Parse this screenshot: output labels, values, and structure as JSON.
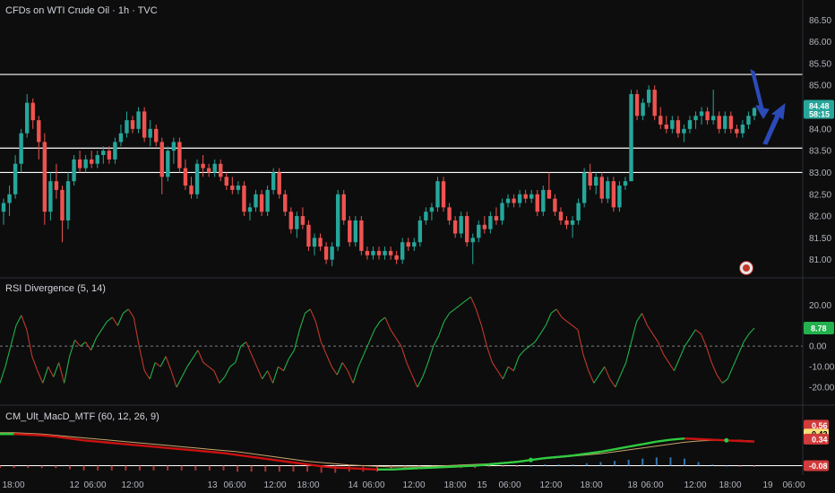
{
  "header": {
    "title": "CFDs on WTI Crude Oil · 1h · TVC",
    "rsi_title": "RSI Divergence (5, 14)",
    "macd_title": "CM_Ult_MacD_MTF (60, 12, 26, 9)"
  },
  "colors": {
    "background": "#0d0d0d",
    "up": "#26a69a",
    "down": "#ef5350",
    "rsi_up": "#22b14c",
    "rsi_down": "#c0392b",
    "hline": "#ffffff",
    "arrow": "#2b4bb8"
  },
  "chart_data": [
    {
      "type": "candlestick",
      "title": "CFDs on WTI Crude Oil · 1h · TVC",
      "y_ticks": [
        "86.50",
        "86.00",
        "85.50",
        "85.00",
        "84.50",
        "84.00",
        "83.50",
        "83.00",
        "82.50",
        "82.00",
        "81.50",
        "81.00"
      ],
      "ylim": [
        80.87,
        86.65
      ],
      "x_ticks": [
        "18:00",
        "12",
        "06:00",
        "12:00",
        "13",
        "06:00",
        "12:00",
        "18:00",
        "14",
        "06:00",
        "12:00",
        "18:00",
        "15",
        "06:00",
        "12:00",
        "18:00",
        "18",
        "06:00",
        "12:00",
        "18:00",
        "19",
        "06:00"
      ],
      "last_price": "84.48",
      "countdown": "58:15",
      "horizontal_levels": [
        85.25,
        83.56,
        83.0
      ],
      "grid": false,
      "candles": [
        {
          "o": 82.1,
          "h": 82.4,
          "l": 81.8,
          "c": 82.3
        },
        {
          "o": 82.3,
          "h": 82.7,
          "l": 82.0,
          "c": 82.5
        },
        {
          "o": 82.5,
          "h": 83.4,
          "l": 82.4,
          "c": 83.2
        },
        {
          "o": 83.2,
          "h": 84.0,
          "l": 83.0,
          "c": 83.9
        },
        {
          "o": 83.9,
          "h": 84.8,
          "l": 83.8,
          "c": 84.6
        },
        {
          "o": 84.6,
          "h": 84.7,
          "l": 84.0,
          "c": 84.2
        },
        {
          "o": 84.2,
          "h": 84.3,
          "l": 83.3,
          "c": 83.7
        },
        {
          "o": 83.7,
          "h": 83.9,
          "l": 81.8,
          "c": 82.1
        },
        {
          "o": 82.1,
          "h": 83.0,
          "l": 81.9,
          "c": 82.8
        },
        {
          "o": 82.8,
          "h": 83.2,
          "l": 82.4,
          "c": 82.6
        },
        {
          "o": 82.6,
          "h": 82.7,
          "l": 81.4,
          "c": 81.9
        },
        {
          "o": 81.9,
          "h": 83.0,
          "l": 81.7,
          "c": 82.8
        },
        {
          "o": 82.8,
          "h": 83.4,
          "l": 82.7,
          "c": 83.3
        },
        {
          "o": 83.3,
          "h": 83.5,
          "l": 83.0,
          "c": 83.1
        },
        {
          "o": 83.1,
          "h": 83.4,
          "l": 83.0,
          "c": 83.3
        },
        {
          "o": 83.3,
          "h": 83.5,
          "l": 83.1,
          "c": 83.2
        },
        {
          "o": 83.2,
          "h": 83.5,
          "l": 83.1,
          "c": 83.4
        },
        {
          "o": 83.4,
          "h": 83.6,
          "l": 83.2,
          "c": 83.5
        },
        {
          "o": 83.5,
          "h": 83.6,
          "l": 83.2,
          "c": 83.3
        },
        {
          "o": 83.3,
          "h": 83.8,
          "l": 83.2,
          "c": 83.7
        },
        {
          "o": 83.7,
          "h": 84.1,
          "l": 83.6,
          "c": 83.9
        },
        {
          "o": 83.9,
          "h": 84.4,
          "l": 83.8,
          "c": 84.2
        },
        {
          "o": 84.2,
          "h": 84.3,
          "l": 83.9,
          "c": 84.0
        },
        {
          "o": 84.0,
          "h": 84.5,
          "l": 83.9,
          "c": 84.4
        },
        {
          "o": 84.4,
          "h": 84.5,
          "l": 83.7,
          "c": 83.8
        },
        {
          "o": 83.8,
          "h": 84.2,
          "l": 83.6,
          "c": 84.0
        },
        {
          "o": 84.0,
          "h": 84.1,
          "l": 83.6,
          "c": 83.7
        },
        {
          "o": 83.7,
          "h": 83.8,
          "l": 82.5,
          "c": 82.9
        },
        {
          "o": 82.9,
          "h": 83.6,
          "l": 82.8,
          "c": 83.5
        },
        {
          "o": 83.5,
          "h": 83.8,
          "l": 83.2,
          "c": 83.7
        },
        {
          "o": 83.7,
          "h": 83.8,
          "l": 83.0,
          "c": 83.1
        },
        {
          "o": 83.1,
          "h": 83.3,
          "l": 82.6,
          "c": 82.7
        },
        {
          "o": 82.7,
          "h": 82.9,
          "l": 82.4,
          "c": 82.5
        },
        {
          "o": 82.5,
          "h": 83.3,
          "l": 82.4,
          "c": 83.2
        },
        {
          "o": 83.2,
          "h": 83.4,
          "l": 82.9,
          "c": 83.1
        },
        {
          "o": 83.1,
          "h": 83.2,
          "l": 82.9,
          "c": 83.0
        },
        {
          "o": 83.0,
          "h": 83.3,
          "l": 82.9,
          "c": 83.2
        },
        {
          "o": 83.2,
          "h": 83.3,
          "l": 82.8,
          "c": 82.9
        },
        {
          "o": 82.9,
          "h": 83.0,
          "l": 82.6,
          "c": 82.7
        },
        {
          "o": 82.7,
          "h": 82.9,
          "l": 82.5,
          "c": 82.6
        },
        {
          "o": 82.6,
          "h": 82.8,
          "l": 82.5,
          "c": 82.7
        },
        {
          "o": 82.7,
          "h": 82.8,
          "l": 82.0,
          "c": 82.1
        },
        {
          "o": 82.1,
          "h": 82.3,
          "l": 81.9,
          "c": 82.2
        },
        {
          "o": 82.2,
          "h": 82.6,
          "l": 82.1,
          "c": 82.5
        },
        {
          "o": 82.5,
          "h": 82.6,
          "l": 82.0,
          "c": 82.1
        },
        {
          "o": 82.1,
          "h": 82.7,
          "l": 82.0,
          "c": 82.6
        },
        {
          "o": 82.6,
          "h": 83.1,
          "l": 82.5,
          "c": 83.0
        },
        {
          "o": 83.0,
          "h": 83.1,
          "l": 82.4,
          "c": 82.5
        },
        {
          "o": 82.5,
          "h": 82.6,
          "l": 82.0,
          "c": 82.1
        },
        {
          "o": 82.1,
          "h": 82.2,
          "l": 81.6,
          "c": 81.7
        },
        {
          "o": 81.7,
          "h": 82.1,
          "l": 81.5,
          "c": 82.0
        },
        {
          "o": 82.0,
          "h": 82.2,
          "l": 81.7,
          "c": 81.8
        },
        {
          "o": 81.8,
          "h": 81.9,
          "l": 81.2,
          "c": 81.3
        },
        {
          "o": 81.3,
          "h": 81.6,
          "l": 81.1,
          "c": 81.5
        },
        {
          "o": 81.5,
          "h": 81.6,
          "l": 81.2,
          "c": 81.3
        },
        {
          "o": 81.3,
          "h": 81.4,
          "l": 80.9,
          "c": 81.0
        },
        {
          "o": 81.0,
          "h": 81.4,
          "l": 80.85,
          "c": 81.3
        },
        {
          "o": 81.3,
          "h": 82.6,
          "l": 81.2,
          "c": 82.5
        },
        {
          "o": 82.5,
          "h": 82.6,
          "l": 81.8,
          "c": 81.9
        },
        {
          "o": 81.9,
          "h": 82.0,
          "l": 81.3,
          "c": 81.4
        },
        {
          "o": 81.4,
          "h": 82.0,
          "l": 81.3,
          "c": 81.9
        },
        {
          "o": 81.9,
          "h": 82.0,
          "l": 81.1,
          "c": 81.2
        },
        {
          "o": 81.2,
          "h": 81.3,
          "l": 81.0,
          "c": 81.1
        },
        {
          "o": 81.1,
          "h": 81.3,
          "l": 81.0,
          "c": 81.2
        },
        {
          "o": 81.2,
          "h": 81.3,
          "l": 81.0,
          "c": 81.1
        },
        {
          "o": 81.1,
          "h": 81.3,
          "l": 81.0,
          "c": 81.2
        },
        {
          "o": 81.2,
          "h": 81.3,
          "l": 81.0,
          "c": 81.1
        },
        {
          "o": 81.1,
          "h": 81.2,
          "l": 80.9,
          "c": 81.0
        },
        {
          "o": 81.0,
          "h": 81.5,
          "l": 80.9,
          "c": 81.4
        },
        {
          "o": 81.4,
          "h": 81.5,
          "l": 81.2,
          "c": 81.3
        },
        {
          "o": 81.3,
          "h": 81.5,
          "l": 81.2,
          "c": 81.4
        },
        {
          "o": 81.4,
          "h": 82.0,
          "l": 81.3,
          "c": 81.9
        },
        {
          "o": 81.9,
          "h": 82.2,
          "l": 81.8,
          "c": 82.1
        },
        {
          "o": 82.1,
          "h": 82.3,
          "l": 81.9,
          "c": 82.2
        },
        {
          "o": 82.2,
          "h": 82.9,
          "l": 82.1,
          "c": 82.8
        },
        {
          "o": 82.8,
          "h": 82.9,
          "l": 82.1,
          "c": 82.2
        },
        {
          "o": 82.2,
          "h": 82.3,
          "l": 81.8,
          "c": 81.9
        },
        {
          "o": 81.9,
          "h": 82.0,
          "l": 81.5,
          "c": 81.6
        },
        {
          "o": 81.6,
          "h": 82.1,
          "l": 81.5,
          "c": 82.0
        },
        {
          "o": 82.0,
          "h": 82.1,
          "l": 81.3,
          "c": 81.4
        },
        {
          "o": 81.4,
          "h": 81.6,
          "l": 80.9,
          "c": 81.5
        },
        {
          "o": 81.5,
          "h": 81.9,
          "l": 81.4,
          "c": 81.8
        },
        {
          "o": 81.8,
          "h": 82.0,
          "l": 81.6,
          "c": 81.7
        },
        {
          "o": 81.7,
          "h": 82.1,
          "l": 81.6,
          "c": 82.0
        },
        {
          "o": 82.0,
          "h": 82.2,
          "l": 81.8,
          "c": 81.9
        },
        {
          "o": 81.9,
          "h": 82.4,
          "l": 81.8,
          "c": 82.3
        },
        {
          "o": 82.3,
          "h": 82.5,
          "l": 82.2,
          "c": 82.4
        },
        {
          "o": 82.4,
          "h": 82.5,
          "l": 82.2,
          "c": 82.3
        },
        {
          "o": 82.3,
          "h": 82.6,
          "l": 82.2,
          "c": 82.5
        },
        {
          "o": 82.5,
          "h": 82.6,
          "l": 82.3,
          "c": 82.4
        },
        {
          "o": 82.4,
          "h": 82.6,
          "l": 82.3,
          "c": 82.5
        },
        {
          "o": 82.5,
          "h": 82.6,
          "l": 82.0,
          "c": 82.1
        },
        {
          "o": 82.1,
          "h": 82.7,
          "l": 82.0,
          "c": 82.6
        },
        {
          "o": 82.6,
          "h": 83.0,
          "l": 82.5,
          "c": 82.4
        },
        {
          "o": 82.4,
          "h": 82.5,
          "l": 82.0,
          "c": 82.1
        },
        {
          "o": 82.1,
          "h": 82.2,
          "l": 81.8,
          "c": 81.9
        },
        {
          "o": 81.9,
          "h": 82.0,
          "l": 81.7,
          "c": 81.8
        },
        {
          "o": 81.8,
          "h": 82.0,
          "l": 81.5,
          "c": 81.9
        },
        {
          "o": 81.9,
          "h": 82.4,
          "l": 81.8,
          "c": 82.3
        },
        {
          "o": 82.3,
          "h": 83.1,
          "l": 82.2,
          "c": 83.0
        },
        {
          "o": 83.0,
          "h": 83.2,
          "l": 82.6,
          "c": 82.7
        },
        {
          "o": 82.7,
          "h": 83.0,
          "l": 82.5,
          "c": 82.9
        },
        {
          "o": 82.9,
          "h": 83.0,
          "l": 82.3,
          "c": 82.4
        },
        {
          "o": 82.4,
          "h": 82.9,
          "l": 82.3,
          "c": 82.8
        },
        {
          "o": 82.8,
          "h": 82.9,
          "l": 82.1,
          "c": 82.2
        },
        {
          "o": 82.2,
          "h": 82.8,
          "l": 82.1,
          "c": 82.7
        },
        {
          "o": 82.7,
          "h": 82.9,
          "l": 82.6,
          "c": 82.8
        },
        {
          "o": 82.8,
          "h": 84.9,
          "l": 82.8,
          "c": 84.8
        },
        {
          "o": 84.8,
          "h": 84.9,
          "l": 84.2,
          "c": 84.3
        },
        {
          "o": 84.3,
          "h": 84.7,
          "l": 84.2,
          "c": 84.6
        },
        {
          "o": 84.6,
          "h": 85.0,
          "l": 84.5,
          "c": 84.9
        },
        {
          "o": 84.9,
          "h": 85.0,
          "l": 84.2,
          "c": 84.3
        },
        {
          "o": 84.3,
          "h": 84.5,
          "l": 84.0,
          "c": 84.1
        },
        {
          "o": 84.1,
          "h": 84.3,
          "l": 83.9,
          "c": 84.0
        },
        {
          "o": 84.0,
          "h": 84.3,
          "l": 83.9,
          "c": 84.2
        },
        {
          "o": 84.2,
          "h": 84.3,
          "l": 83.8,
          "c": 83.9
        },
        {
          "o": 83.9,
          "h": 84.1,
          "l": 83.7,
          "c": 84.0
        },
        {
          "o": 84.0,
          "h": 84.3,
          "l": 83.9,
          "c": 84.2
        },
        {
          "o": 84.2,
          "h": 84.4,
          "l": 84.0,
          "c": 84.3
        },
        {
          "o": 84.3,
          "h": 84.5,
          "l": 84.1,
          "c": 84.4
        },
        {
          "o": 84.4,
          "h": 84.5,
          "l": 84.1,
          "c": 84.2
        },
        {
          "o": 84.2,
          "h": 84.9,
          "l": 84.1,
          "c": 84.3
        },
        {
          "o": 84.3,
          "h": 84.4,
          "l": 83.9,
          "c": 84.0
        },
        {
          "o": 84.0,
          "h": 84.4,
          "l": 83.9,
          "c": 84.3
        },
        {
          "o": 84.3,
          "h": 84.4,
          "l": 83.9,
          "c": 84.0
        },
        {
          "o": 84.0,
          "h": 84.1,
          "l": 83.8,
          "c": 83.9
        },
        {
          "o": 83.9,
          "h": 84.2,
          "l": 83.8,
          "c": 84.1
        },
        {
          "o": 84.1,
          "h": 84.4,
          "l": 84.0,
          "c": 84.3
        },
        {
          "o": 84.3,
          "h": 84.5,
          "l": 84.2,
          "c": 84.48
        }
      ]
    },
    {
      "type": "line",
      "title": "RSI Divergence (5, 14)",
      "y_ticks": [
        "20.00",
        "10.00",
        "0.00",
        "-10.00",
        "-20.00"
      ],
      "ylim": [
        -27,
        28
      ],
      "current_value": "8.78",
      "zero_line": true,
      "series": [
        {
          "values": [
            -18,
            -10,
            0,
            10,
            15,
            8,
            -5,
            -12,
            -18,
            -10,
            -15,
            -8,
            -18,
            -5,
            3,
            0,
            2,
            -2,
            4,
            8,
            12,
            14,
            10,
            16,
            18,
            14,
            0,
            -12,
            -16,
            -8,
            -10,
            -5,
            -12,
            -20,
            -15,
            -10,
            -6,
            -2,
            -8,
            -10,
            -12,
            -18,
            -15,
            -10,
            -8,
            0,
            2,
            -4,
            -10,
            -16,
            -12,
            -18,
            -10,
            -12,
            -6,
            -2,
            8,
            16,
            18,
            12,
            2,
            -4,
            -10,
            -14,
            -8,
            -12,
            -18,
            -10,
            -4,
            2,
            8,
            12,
            14,
            8,
            4,
            0,
            -8,
            -14,
            -20,
            -15,
            -8,
            0,
            5,
            12,
            16,
            18,
            20,
            22,
            24,
            18,
            10,
            0,
            -8,
            -12,
            -16,
            -10,
            -12,
            -5,
            -2,
            0,
            2,
            6,
            10,
            16,
            18,
            14,
            12,
            10,
            8,
            -4,
            -12,
            -18,
            -14,
            -10,
            -16,
            -20,
            -14,
            -8,
            2,
            12,
            16,
            10,
            6,
            2,
            -4,
            -8,
            -12,
            -6,
            0,
            4,
            8,
            6,
            0,
            -8,
            -14,
            -18,
            -16,
            -10,
            -4,
            2,
            6,
            8.78
          ]
        }
      ]
    },
    {
      "type": "line",
      "title": "CM_Ult_MacD_MTF (60, 12, 26, 9)",
      "y_ticks": [],
      "ylim": [
        -0.2,
        0.65
      ],
      "labels": [
        "0.56",
        "0.42",
        "0.34",
        "-0.08"
      ],
      "series": [
        {
          "values": [
            0.42,
            0.42,
            0.41,
            0.4,
            0.38,
            0.35,
            0.32,
            0.3,
            0.28,
            0.26,
            0.24,
            0.22,
            0.2,
            0.18,
            0.16,
            0.14,
            0.12,
            0.09,
            0.06,
            0.03,
            0.0,
            -0.03,
            -0.06,
            -0.09,
            -0.11,
            -0.12,
            -0.13,
            -0.14,
            -0.14,
            -0.13,
            -0.12,
            -0.11,
            -0.1,
            -0.09,
            -0.08,
            -0.06,
            -0.04,
            -0.02,
            0.01,
            0.04,
            0.06,
            0.08,
            0.11,
            0.14,
            0.18,
            0.22,
            0.26,
            0.3,
            0.33,
            0.35,
            0.34,
            0.33,
            0.32,
            0.31,
            0.3
          ]
        },
        {
          "values": [
            0.44,
            0.44,
            0.43,
            0.42,
            0.4,
            0.38,
            0.36,
            0.34,
            0.32,
            0.3,
            0.28,
            0.26,
            0.24,
            0.22,
            0.2,
            0.18,
            0.16,
            0.14,
            0.11,
            0.08,
            0.05,
            0.02,
            -0.01,
            -0.03,
            -0.05,
            -0.07,
            -0.08,
            -0.09,
            -0.1,
            -0.1,
            -0.1,
            -0.09,
            -0.08,
            -0.07,
            -0.06,
            -0.05,
            -0.03,
            -0.01,
            0.01,
            0.03,
            0.05,
            0.07,
            0.09,
            0.11,
            0.14,
            0.17,
            0.2,
            0.23,
            0.26,
            0.29,
            0.31,
            0.32,
            0.32,
            0.32,
            0.31
          ]
        }
      ]
    }
  ]
}
